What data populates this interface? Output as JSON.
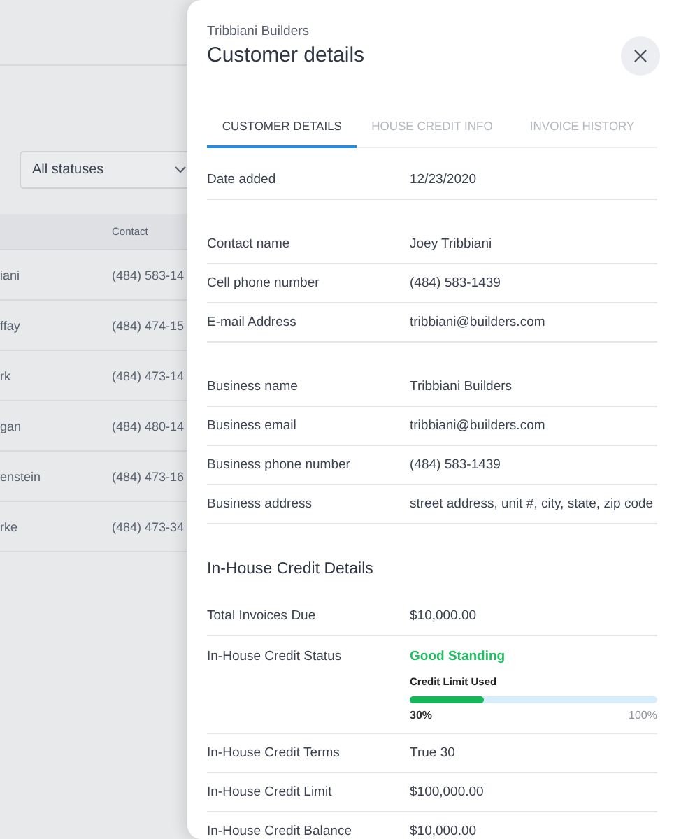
{
  "background": {
    "filter": {
      "value": "All statuses"
    },
    "table": {
      "contact_header": "Contact",
      "rows": [
        {
          "column_1": "iani",
          "contact": "(484) 583-14"
        },
        {
          "column_1": "ffay",
          "contact": "(484) 474-15"
        },
        {
          "column_1": "rk",
          "contact": "(484) 473-14"
        },
        {
          "column_1": "gan",
          "contact": "(484) 480-14"
        },
        {
          "column_1": "enstein",
          "contact": "(484) 473-16"
        },
        {
          "column_1": "rke",
          "contact": "(484) 473-34"
        }
      ]
    }
  },
  "panel": {
    "subtitle": "Tribbiani Builders",
    "title": "Customer details",
    "tabs": [
      {
        "label": "CUSTOMER DETAILS",
        "selected": true
      },
      {
        "label": "HOUSE CREDIT INFO",
        "selected": false
      },
      {
        "label": "INVOICE HISTORY",
        "selected": false
      }
    ],
    "sections": [
      {
        "rows": [
          {
            "kind": "text",
            "label": "Date added",
            "value": "12/23/2020"
          }
        ]
      },
      {
        "rows": [
          {
            "kind": "text",
            "label": "Contact name",
            "value": "Joey Tribbiani"
          },
          {
            "kind": "text",
            "label": "Cell phone number",
            "value": "(484) 583-1439"
          },
          {
            "kind": "text",
            "label": "E-mail Address",
            "value": "tribbiani@builders.com"
          }
        ]
      },
      {
        "rows": [
          {
            "kind": "text",
            "label": "Business name",
            "value": "Tribbiani Builders"
          },
          {
            "kind": "text",
            "label": "Business email",
            "value": "tribbiani@builders.com"
          },
          {
            "kind": "text",
            "label": "Business phone number",
            "value": "(484) 583-1439"
          },
          {
            "kind": "text",
            "label": "Business address",
            "value": "street address, unit #, city, state, zip code"
          }
        ]
      },
      {
        "heading": "In-House Credit Details",
        "rows": [
          {
            "kind": "text",
            "label": "Total Invoices Due",
            "value": "$10,000.00"
          },
          {
            "kind": "status",
            "label": "In-House Credit Status",
            "value": "Good Standing",
            "meter": {
              "label": "Credit Limit Used",
              "level": 0.3,
              "reading": "30%",
              "max": "100%"
            }
          },
          {
            "kind": "text",
            "label": "In-House Credit Terms",
            "value": "True 30"
          },
          {
            "kind": "text",
            "label": "In-House Credit Limit",
            "value": "$100,000.00"
          },
          {
            "kind": "text",
            "label": "In-House Credit Balance",
            "value": "$10,000.00"
          }
        ]
      }
    ]
  }
}
